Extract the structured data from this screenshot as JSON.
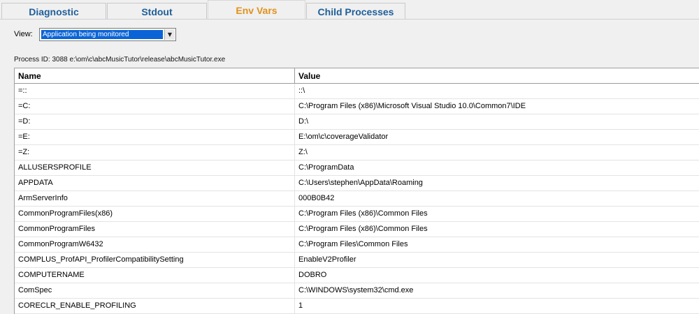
{
  "tabs": [
    {
      "label": "Diagnostic",
      "active": false
    },
    {
      "label": "Stdout",
      "active": false
    },
    {
      "label": "Env Vars",
      "active": true
    },
    {
      "label": "Child Processes",
      "active": false
    }
  ],
  "view": {
    "label": "View:",
    "selected": "Application being monitored"
  },
  "process_info": "Process ID: 3088 e:\\om\\c\\abcMusicTutor\\release\\abcMusicTutor.exe",
  "table": {
    "columns": [
      "Name",
      "Value"
    ],
    "rows": [
      {
        "name": "=::",
        "value": "::\\"
      },
      {
        "name": "=C:",
        "value": "C:\\Program Files (x86)\\Microsoft Visual Studio 10.0\\Common7\\IDE"
      },
      {
        "name": "=D:",
        "value": "D:\\"
      },
      {
        "name": "=E:",
        "value": "E:\\om\\c\\coverageValidator"
      },
      {
        "name": "=Z:",
        "value": "Z:\\"
      },
      {
        "name": "ALLUSERSPROFILE",
        "value": "C:\\ProgramData"
      },
      {
        "name": "APPDATA",
        "value": "C:\\Users\\stephen\\AppData\\Roaming"
      },
      {
        "name": "ArmServerInfo",
        "value": "000B0B42"
      },
      {
        "name": "CommonProgramFiles(x86)",
        "value": "C:\\Program Files (x86)\\Common Files"
      },
      {
        "name": "CommonProgramFiles",
        "value": "C:\\Program Files (x86)\\Common Files"
      },
      {
        "name": "CommonProgramW6432",
        "value": "C:\\Program Files\\Common Files"
      },
      {
        "name": "COMPLUS_ProfAPI_ProfilerCompatibilitySetting",
        "value": "EnableV2Profiler"
      },
      {
        "name": "COMPUTERNAME",
        "value": "DOBRO"
      },
      {
        "name": "ComSpec",
        "value": "C:\\WINDOWS\\system32\\cmd.exe"
      },
      {
        "name": "CORECLR_ENABLE_PROFILING",
        "value": "1"
      }
    ]
  }
}
